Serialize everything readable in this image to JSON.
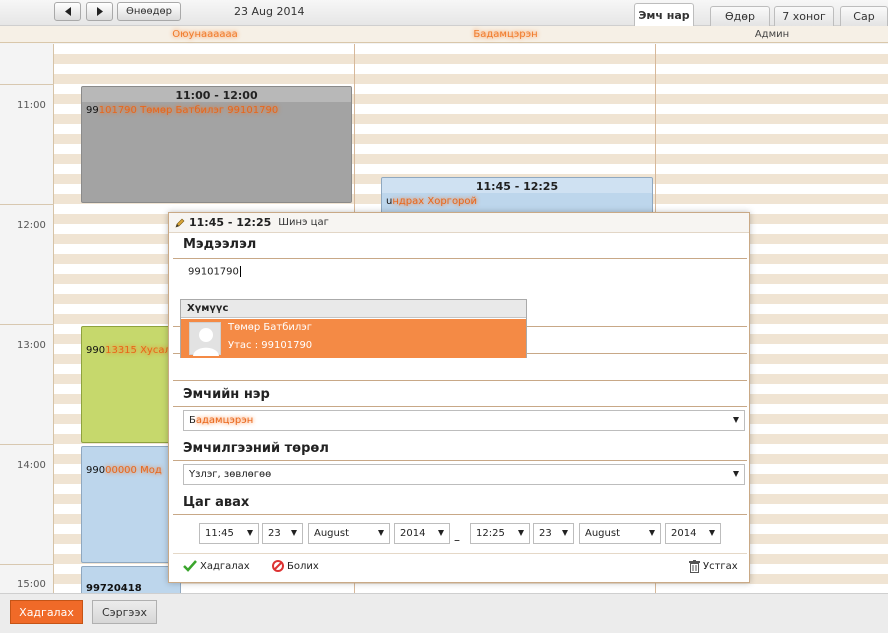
{
  "toolbar": {
    "prev_icon": "chevron-left-icon",
    "next_icon": "chevron-right-icon",
    "today_label": "Өнөөдөр",
    "date": "23 Aug 2014",
    "tabs": [
      "Эмч нар",
      "Өдөр",
      "7 хоног",
      "Сар"
    ],
    "active_tab": "Эмч нар"
  },
  "columns": [
    {
      "name": "Оюунаааааа"
    },
    {
      "name": "Бадамцэрэн"
    },
    {
      "name": "Админ"
    }
  ],
  "times": [
    "11:00",
    "12:00",
    "13:00",
    "14:00",
    "15:00"
  ],
  "events": [
    {
      "time": "11:00 - 12:00",
      "text_visible": "99",
      "text_blurred": "101790 Төмөр Батбилэг 99101790"
    },
    {
      "time": "11:45 - 12:25",
      "text_visible": "u",
      "text_blurred": "ндрах Хоргорой"
    },
    {
      "time": "",
      "text_visible": "990",
      "text_blurred": "13315 Хусал"
    },
    {
      "time": "",
      "text_visible": "990",
      "text_blurred": "00000 Мод"
    },
    {
      "time": "",
      "text_visible": "99720418",
      "text_blurred": ""
    }
  ],
  "modal": {
    "pencil_icon": "pencil-icon",
    "time": "11:45 - 12:25",
    "status": "Шинэ цаг",
    "info_title": "Мэдээлэл",
    "phone_value": "99101790",
    "autocomplete": {
      "header": "Хүмүүс",
      "name": "Төмөр Батбилэг",
      "phone": "Утас : 99101790"
    },
    "doctor_title": "Эмчийн нэр",
    "doctor_value_visible": "Б",
    "doctor_value_blurred": "адамцэрэн",
    "treatment_title": "Эмчилгээний төрөл",
    "treatment_value": "Үзлэг, зөвлөгөө",
    "appt_title": "Цаг авах",
    "start": {
      "time": "11:45",
      "day": "23",
      "month": "August",
      "year": "2014"
    },
    "separator": "–",
    "end": {
      "time": "12:25",
      "day": "23",
      "month": "August",
      "year": "2014"
    },
    "save_label": "Хадгалах",
    "cancel_label": "Болих",
    "delete_label": "Устгах"
  },
  "bottom": {
    "save_label": "Хадгалах",
    "refresh_label": "Сэргээх"
  },
  "colors": {
    "accent": "#f06a28",
    "event_gray": "#a3a3a3",
    "event_blue": "#bdd6ec",
    "event_green": "#c6d86c"
  }
}
